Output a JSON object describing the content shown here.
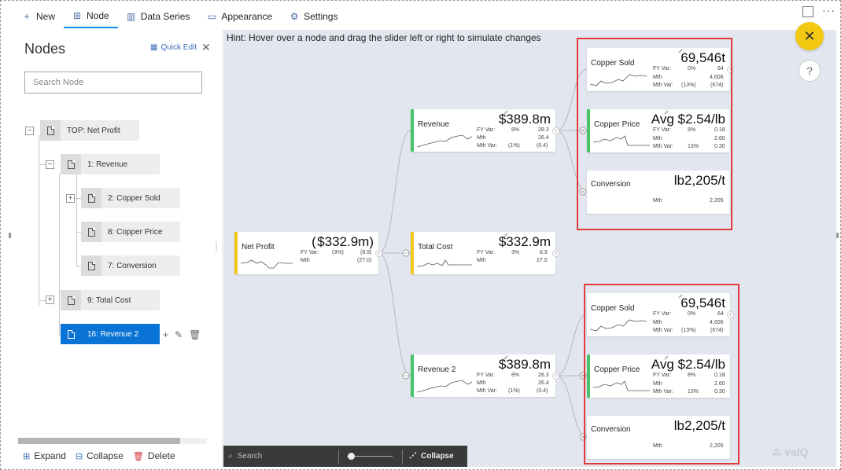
{
  "toolbar": {
    "new_label": "New",
    "node_label": "Node",
    "data_series_label": "Data Series",
    "appearance_label": "Appearance",
    "settings_label": "Settings",
    "more_label": "···"
  },
  "left_panel": {
    "title": "Nodes",
    "quick_edit": "Quick Edit",
    "close": "✕",
    "search_placeholder": "Search Node",
    "tree": [
      {
        "label": "TOP: Net Profit",
        "toggle": "−"
      },
      {
        "label": "1: Revenue",
        "toggle": "−"
      },
      {
        "label": "2: Copper Sold",
        "toggle": "+"
      },
      {
        "label": "8: Copper Price",
        "toggle": ""
      },
      {
        "label": "7: Conversion",
        "toggle": ""
      },
      {
        "label": "9: Total Cost",
        "toggle": "+"
      },
      {
        "label": "16: Revenue 2",
        "toggle": "",
        "selected": true
      }
    ],
    "bottom": {
      "expand": "Expand",
      "collapse": "Collapse",
      "delete": "Delete"
    }
  },
  "canvas": {
    "hint": "Hint: Hover over a node and drag the slider left or right to simulate changes",
    "bar": {
      "search": "Search",
      "collapse": "Collapse"
    },
    "logo": "valQ",
    "cards": {
      "net_profit": {
        "name": "Net Profit",
        "value": "( $332.9m)",
        "stats": [
          [
            "FY Var:",
            "(3%)",
            "(8.9)"
          ],
          [
            "Mth",
            "",
            "(27.0)"
          ]
        ]
      },
      "revenue": {
        "name": "Revenue",
        "value": "$389.8m",
        "stats": [
          [
            "FY Var:",
            "8%",
            "28.3"
          ],
          [
            "Mth",
            "",
            "26.4"
          ],
          [
            "Mth Var:",
            "(1%)",
            "(0.4)"
          ]
        ]
      },
      "total_cost": {
        "name": "Total Cost",
        "value": "$332.9m",
        "stats": [
          [
            "FY Var:",
            "3%",
            "8.9"
          ],
          [
            "Mth",
            "",
            "27.0"
          ]
        ]
      },
      "revenue2": {
        "name": "Revenue 2",
        "value": "$389.8m",
        "stats": [
          [
            "FY Var:",
            "8%",
            "28.3"
          ],
          [
            "Mth",
            "",
            "26.4"
          ],
          [
            "Mth Var:",
            "(1%)",
            "(0.4)"
          ]
        ]
      },
      "copper_sold": {
        "name": "Copper Sold",
        "value": "69,546t",
        "stats": [
          [
            "FY Var:",
            "0%",
            "64"
          ],
          [
            "Mth",
            "",
            "4,606"
          ],
          [
            "Mth Var:",
            "(13%)",
            "(674)"
          ]
        ]
      },
      "copper_price": {
        "name": "Copper Price",
        "value": "Avg $2.54/lb",
        "stats": [
          [
            "FY Var:",
            "8%",
            "0.18"
          ],
          [
            "Mth",
            "",
            "2.60"
          ],
          [
            "Mth Var:",
            "13%",
            "0.30"
          ]
        ]
      },
      "conversion": {
        "name": "Conversion",
        "value": "lb2,205/t",
        "stats": [
          [
            "Mth",
            "",
            "2,205"
          ]
        ]
      }
    }
  },
  "floating": {
    "close": "✕",
    "help": "?"
  },
  "colors": {
    "accent_green": "#47c36b",
    "accent_yellow": "#f5c518",
    "highlight_red": "#e03c3c",
    "selected_blue": "#0a74d6",
    "close_yellow": "#f2c811"
  }
}
